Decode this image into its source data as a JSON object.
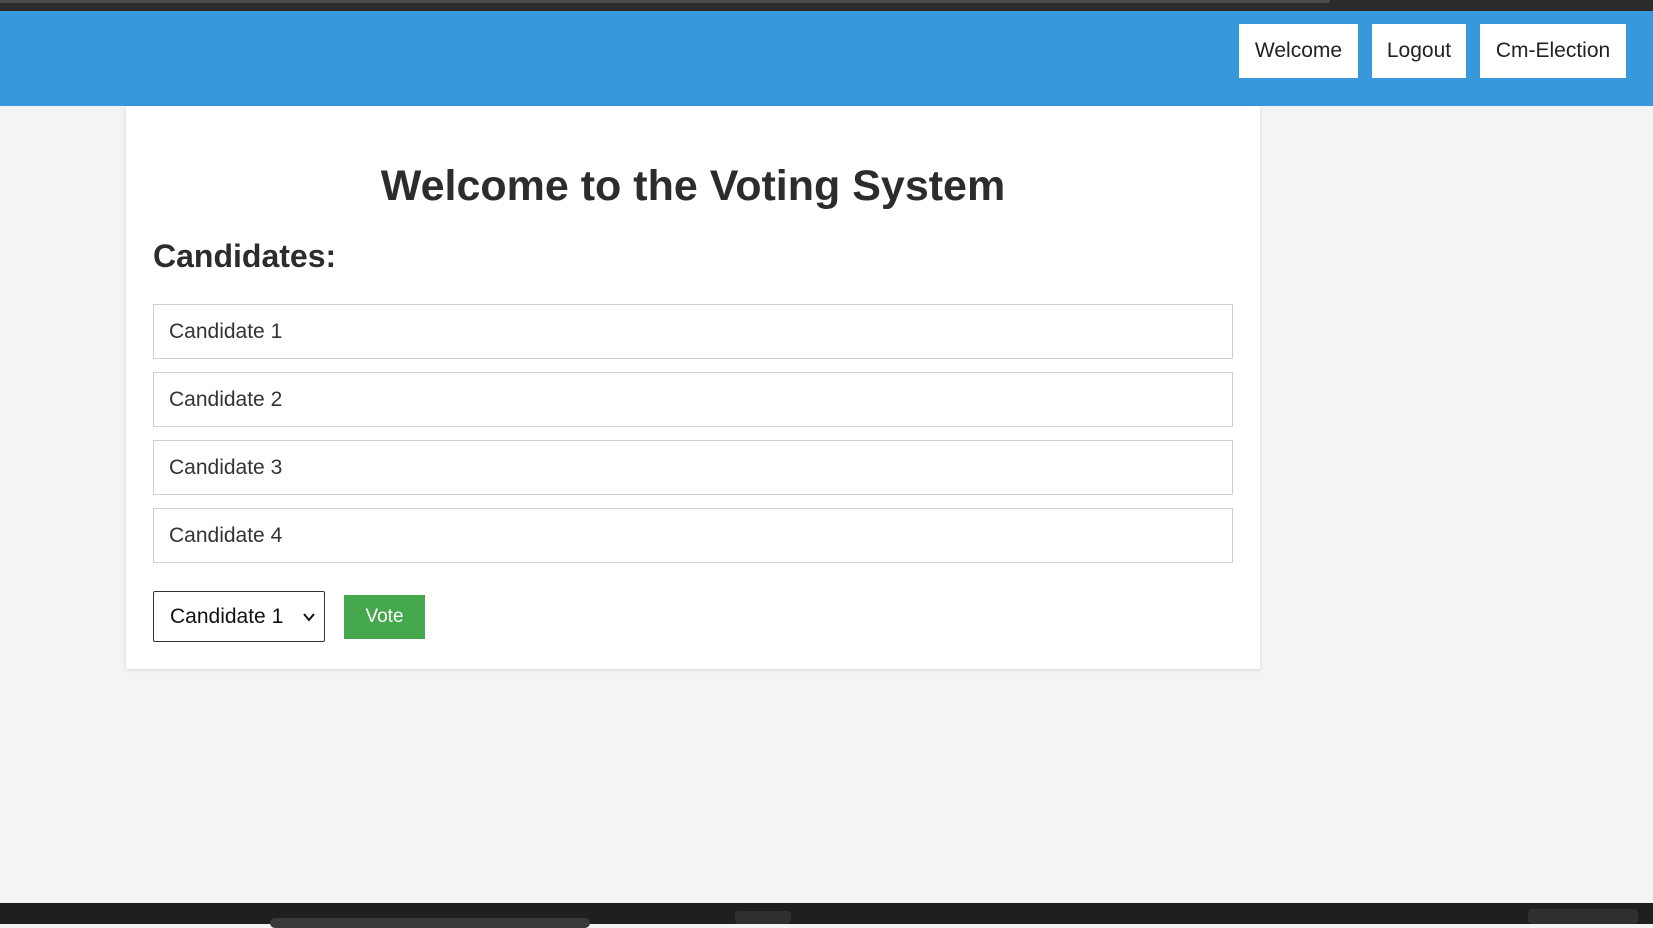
{
  "nav": {
    "welcome_label": "Welcome",
    "logout_label": "Logout",
    "election_label": "Cm-Election"
  },
  "main": {
    "title": "Welcome to the Voting System",
    "candidates_heading": "Candidates:",
    "candidates": [
      "Candidate 1",
      "Candidate 2",
      "Candidate 3",
      "Candidate 4"
    ],
    "select_value": "Candidate 1",
    "vote_label": "Vote"
  },
  "colors": {
    "navbar": "#3898dc",
    "vote_button": "#46a84c",
    "page_background": "#f4f4f4"
  }
}
